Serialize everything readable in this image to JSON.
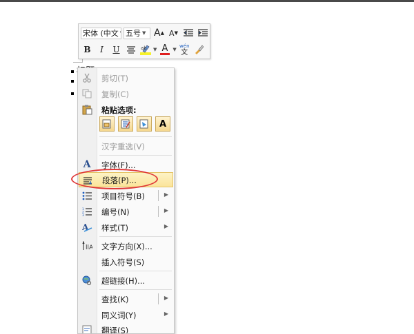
{
  "document": {
    "lines": [
      "标题",
      "",
      ""
    ]
  },
  "mini_toolbar": {
    "font_name": "宋体 (中文",
    "font_size": "五号",
    "grow_font": "A",
    "shrink_font": "A",
    "bold": "B",
    "italic": "I",
    "underline": "U",
    "font_color_glyph": "A",
    "phonetic_top": "wén",
    "phonetic_bottom": "文",
    "highlight_color": "#f6f22a",
    "font_color": "#e02020"
  },
  "context_menu": {
    "items": [
      {
        "label": "剪切(T)",
        "icon": "scissors-icon",
        "enabled": false
      },
      {
        "label": "复制(C)",
        "icon": "copy-icon",
        "enabled": false
      },
      {
        "label": "粘贴选项:",
        "icon": "paste-icon",
        "enabled": true
      },
      {
        "label": "汉字重选(V)",
        "icon": "",
        "enabled": false
      },
      {
        "label": "字体(F)...",
        "icon": "font-icon",
        "enabled": true
      },
      {
        "label": "段落(P)...",
        "icon": "paragraph-icon",
        "enabled": true,
        "highlighted": true
      },
      {
        "label": "项目符号(B)",
        "icon": "bullets-icon",
        "enabled": true,
        "submenu": true
      },
      {
        "label": "编号(N)",
        "icon": "numbering-icon",
        "enabled": true,
        "submenu": true
      },
      {
        "label": "样式(T)",
        "icon": "styles-icon",
        "enabled": true,
        "submenu": true
      },
      {
        "label": "文字方向(X)...",
        "icon": "text-direction-icon",
        "enabled": true
      },
      {
        "label": "插入符号(S)",
        "icon": "",
        "enabled": true
      },
      {
        "label": "超链接(H)...",
        "icon": "hyperlink-icon",
        "enabled": true
      },
      {
        "label": "查找(K)",
        "icon": "",
        "enabled": true,
        "submenu": true
      },
      {
        "label": "同义词(Y)",
        "icon": "",
        "enabled": true,
        "submenu": true
      },
      {
        "label": "翻译(S)",
        "icon": "translate-icon",
        "enabled": true
      }
    ],
    "paste_options": [
      "keep-source-formatting-icon",
      "merge-formatting-icon",
      "picture-icon",
      "keep-text-only-icon"
    ],
    "paste_text_only_glyph": "A",
    "highlight_annotation_color": "#e03a3a"
  }
}
